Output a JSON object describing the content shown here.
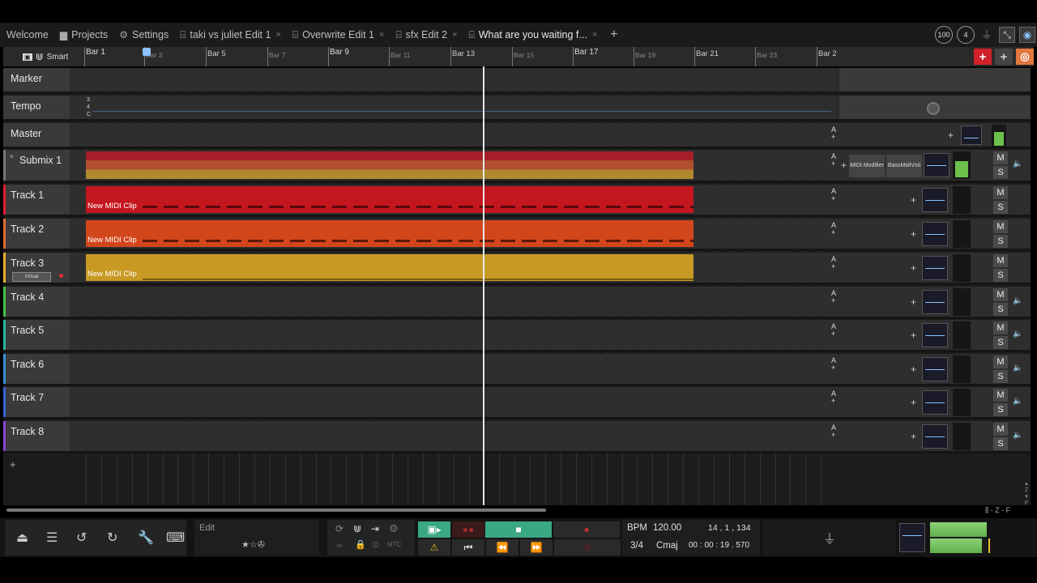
{
  "tabs": [
    {
      "label": "Welcome",
      "icon": ""
    },
    {
      "label": "Projects",
      "icon": "folder-icon"
    },
    {
      "label": "Settings",
      "icon": "gear-icon"
    },
    {
      "label": "taki vs juliet Edit 1",
      "icon": "edit-icon",
      "closable": true
    },
    {
      "label": "Overwrite Edit 1",
      "icon": "edit-icon",
      "closable": true
    },
    {
      "label": "sfx Edit 2",
      "icon": "edit-icon",
      "closable": true
    },
    {
      "label": "What are you waiting f...",
      "icon": "edit-icon",
      "closable": true,
      "active": true
    }
  ],
  "top_right": {
    "cpu": "100",
    "cores": "4"
  },
  "ruler": {
    "mode_label": "Smart",
    "major": [
      "Bar 1",
      "Bar 9",
      "Bar 13",
      "Bar 17",
      "Bar 21",
      "Bar 2"
    ],
    "labels": [
      {
        "t": "Bar 1",
        "major": true
      },
      {
        "t": "Bar 3",
        "major": false
      },
      {
        "t": "Bar 5",
        "major": false
      },
      {
        "t": "Bar 7",
        "major": false
      },
      {
        "t": "Bar 9",
        "major": true
      },
      {
        "t": "Bar 11",
        "major": false
      },
      {
        "t": "Bar 13",
        "major": false
      },
      {
        "t": "Bar 15",
        "major": false
      },
      {
        "t": "Bar 17",
        "major": true
      },
      {
        "t": "Bar 19",
        "major": false
      },
      {
        "t": "Bar 21",
        "major": false
      },
      {
        "t": "Bar 23",
        "major": false
      },
      {
        "t": "Bar 2",
        "major": false
      }
    ]
  },
  "tempo_values": [
    "3",
    "4",
    "C"
  ],
  "tracks": [
    {
      "name": "Marker",
      "type": "marker"
    },
    {
      "name": "Tempo",
      "type": "tempo"
    },
    {
      "name": "Master",
      "type": "master"
    },
    {
      "name": "Submix 1",
      "type": "submix",
      "plugins": [
        "MIDI Modifier",
        "BassMidiVsti"
      ]
    },
    {
      "name": "Track 1",
      "clip": "New MIDI Clip",
      "color": "#c4161f",
      "accent": "#e02030"
    },
    {
      "name": "Track 2",
      "clip": "New MIDI Clip",
      "color": "#d2461c",
      "accent": "#e06a30"
    },
    {
      "name": "Track 3",
      "clip": "New MIDI Clip",
      "color": "#c89a23",
      "accent": "#e8b030",
      "badge": "Virtual"
    },
    {
      "name": "Track 4",
      "accent": "#43c04a"
    },
    {
      "name": "Track 5",
      "accent": "#27b8a0"
    },
    {
      "name": "Track 6",
      "accent": "#3a8cd8"
    },
    {
      "name": "Track 7",
      "accent": "#3a62d8"
    },
    {
      "name": "Track 8",
      "accent": "#8a44d0"
    }
  ],
  "mute_label": "M",
  "solo_label": "S",
  "bottom": {
    "edit_label": "Edit",
    "mtc_label": "MTC",
    "bpm_label": "BPM",
    "bpm_value": "120.00",
    "position": "14 , 1 , 134",
    "time_sig": "3/4",
    "key": "Cmaj",
    "timecode": "00 : 00 : 19 . 570"
  },
  "zoom_label": "Z",
  "fit_label": "F"
}
